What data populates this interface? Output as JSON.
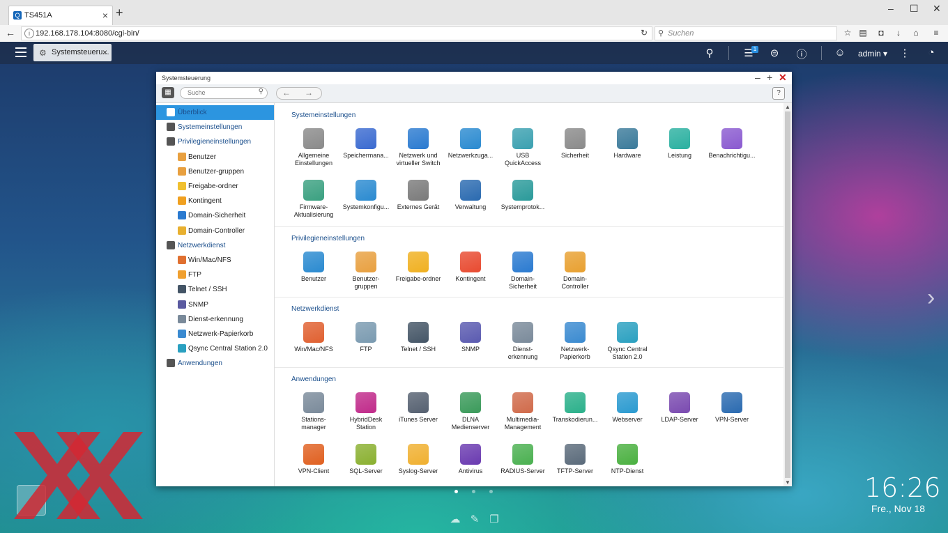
{
  "browser": {
    "tab_title": "TS451A",
    "address": "192.168.178.104:8080/cgi-bin/",
    "search_placeholder": "Suchen"
  },
  "qts": {
    "tab_label": "Systemsteueru...",
    "user": "admin",
    "notification_count": "1"
  },
  "window": {
    "title": "Systemsteuerung",
    "search_placeholder": "Suche",
    "help_label": "?"
  },
  "sidebar": [
    {
      "label": "Überblick",
      "level": "top",
      "selected": true,
      "icon": "overview-icon",
      "color": "#2c95e0"
    },
    {
      "label": "Systemeinstellungen",
      "level": "top",
      "icon": "gear-icon",
      "color": "#555555"
    },
    {
      "label": "Privilegieneinstellungen",
      "level": "top",
      "icon": "user-icon",
      "color": "#555555"
    },
    {
      "label": "Benutzer",
      "level": "sub",
      "icon": "user-icon",
      "color": "#e8a040"
    },
    {
      "label": "Benutzer-gruppen",
      "level": "sub",
      "icon": "users-icon",
      "color": "#e8a040"
    },
    {
      "label": "Freigabe-ordner",
      "level": "sub",
      "icon": "folder-icon",
      "color": "#f0c030"
    },
    {
      "label": "Kontingent",
      "level": "sub",
      "icon": "pie-icon",
      "color": "#f0a020"
    },
    {
      "label": "Domain-Sicherheit",
      "level": "sub",
      "icon": "domain-icon",
      "color": "#2a7ad0"
    },
    {
      "label": "Domain-Controller",
      "level": "sub",
      "icon": "controller-icon",
      "color": "#e8b030"
    },
    {
      "label": "Netzwerkdienst",
      "level": "top",
      "icon": "globe-icon",
      "color": "#555555"
    },
    {
      "label": "Win/Mac/NFS",
      "level": "sub",
      "icon": "triangle-icon",
      "color": "#e07030"
    },
    {
      "label": "FTP",
      "level": "sub",
      "icon": "ftp-icon",
      "color": "#f0a030"
    },
    {
      "label": "Telnet / SSH",
      "level": "sub",
      "icon": "terminal-icon",
      "color": "#445566"
    },
    {
      "label": "SNMP",
      "level": "sub",
      "icon": "chart-icon",
      "color": "#5a5aa0"
    },
    {
      "label": "Dienst-erkennung",
      "level": "sub",
      "icon": "satellite-icon",
      "color": "#7a8a9a"
    },
    {
      "label": "Netzwerk-Papierkorb",
      "level": "sub",
      "icon": "recycle-icon",
      "color": "#3a8ad0"
    },
    {
      "label": "Qsync Central Station 2.0",
      "level": "sub",
      "icon": "sync-icon",
      "color": "#2aa0c0"
    },
    {
      "label": "Anwendungen",
      "level": "top",
      "icon": "apps-icon",
      "color": "#555555"
    }
  ],
  "sections": [
    {
      "title": "Systemeinstellungen",
      "apps": [
        {
          "label": "Allgemeine\nEinstellungen",
          "icon": "settings-icon",
          "color": "#8a8a8a"
        },
        {
          "label": "Speichermana...",
          "icon": "storage-icon",
          "color": "#3a6ad0"
        },
        {
          "label": "Netzwerk und\nvirtueller Switch",
          "icon": "network-icon",
          "color": "#2a7ad0"
        },
        {
          "label": "Netzwerkzuga...",
          "icon": "network-access-icon",
          "color": "#2a8ad0"
        },
        {
          "label": "USB\nQuickAccess",
          "icon": "usb-icon",
          "color": "#3aa0b0"
        },
        {
          "label": "Sicherheit",
          "icon": "lock-icon",
          "color": "#8a8a8a"
        },
        {
          "label": "Hardware",
          "icon": "hardware-icon",
          "color": "#3a7a9a"
        },
        {
          "label": "Leistung",
          "icon": "bulb-icon",
          "color": "#2ab0a0"
        },
        {
          "label": "Benachrichtigu...",
          "icon": "notification-icon",
          "color": "#8a5ad0"
        },
        {
          "label": "Firmware-\nAktualisierung",
          "icon": "firmware-icon",
          "color": "#3aa080"
        },
        {
          "label": "Systemkonfigu...",
          "icon": "sysconfig-icon",
          "color": "#2a8ad0"
        },
        {
          "label": "Externes Gerät",
          "icon": "external-drive-icon",
          "color": "#7a7a7a"
        },
        {
          "label": "Verwaltung",
          "icon": "monitor-icon",
          "color": "#2a6ab0"
        },
        {
          "label": "Systemprotok...",
          "icon": "log-icon",
          "color": "#2a9a9a"
        }
      ]
    },
    {
      "title": "Privilegieneinstellungen",
      "apps": [
        {
          "label": "Benutzer",
          "icon": "user-icon",
          "color": "#2a8ad0"
        },
        {
          "label": "Benutzer-\ngruppen",
          "icon": "users-icon",
          "color": "#e8a040"
        },
        {
          "label": "Freigabe-ordner",
          "icon": "folder-icon",
          "color": "#f0b020"
        },
        {
          "label": "Kontingent",
          "icon": "pie-icon",
          "color": "#e84a30"
        },
        {
          "label": "Domain-\nSicherheit",
          "icon": "domain-icon",
          "color": "#2a7ad0"
        },
        {
          "label": "Domain-\nController",
          "icon": "controller-icon",
          "color": "#e8a030"
        }
      ]
    },
    {
      "title": "Netzwerkdienst",
      "apps": [
        {
          "label": "Win/Mac/NFS",
          "icon": "triangle-icon",
          "color": "#e06030"
        },
        {
          "label": "FTP",
          "icon": "ftp-icon",
          "color": "#7a9ab0"
        },
        {
          "label": "Telnet / SSH",
          "icon": "terminal-icon",
          "color": "#445566"
        },
        {
          "label": "SNMP",
          "icon": "chart-icon",
          "color": "#5a5ab0"
        },
        {
          "label": "Dienst-\nerkennung",
          "icon": "satellite-icon",
          "color": "#7a8a9a"
        },
        {
          "label": "Netzwerk-\nPapierkorb",
          "icon": "recycle-icon",
          "color": "#3a8ad0"
        },
        {
          "label": "Qsync Central\nStation 2.0",
          "icon": "sync-icon",
          "color": "#2aa0c0"
        }
      ]
    },
    {
      "title": "Anwendungen",
      "apps": [
        {
          "label": "Stations-\nmanager",
          "icon": "station-icon",
          "color": "#7a8a9a"
        },
        {
          "label": "HybridDesk\nStation",
          "icon": "hybriddesk-icon",
          "color": "#c02a8a"
        },
        {
          "label": "iTunes Server",
          "icon": "itunes-icon",
          "color": "#556070"
        },
        {
          "label": "DLNA\nMedienserver",
          "icon": "dlna-icon",
          "color": "#3a9a5a"
        },
        {
          "label": "Multimedia-\nManagement",
          "icon": "multimedia-icon",
          "color": "#d06a4a"
        },
        {
          "label": "Transkodierun...",
          "icon": "transcode-icon",
          "color": "#2ab08a"
        },
        {
          "label": "Webserver",
          "icon": "globe-icon",
          "color": "#2a9ad0"
        },
        {
          "label": "LDAP-Server",
          "icon": "ldap-icon",
          "color": "#7a4ab0"
        },
        {
          "label": "VPN-Server",
          "icon": "vpn-server-icon",
          "color": "#2a6ab0"
        },
        {
          "label": "VPN-Client",
          "icon": "vpn-client-icon",
          "color": "#e06020"
        },
        {
          "label": "SQL-Server",
          "icon": "database-icon",
          "color": "#8ab030"
        },
        {
          "label": "Syslog-Server",
          "icon": "syslog-icon",
          "color": "#f0b030"
        },
        {
          "label": "Antivirus",
          "icon": "antivirus-icon",
          "color": "#6a3ab0"
        },
        {
          "label": "RADIUS-Server",
          "icon": "radius-icon",
          "color": "#4ab050"
        },
        {
          "label": "TFTP-Server",
          "icon": "tftp-icon",
          "color": "#5a6a7a"
        },
        {
          "label": "NTP-Dienst",
          "icon": "ntp-icon",
          "color": "#4ab040"
        }
      ]
    }
  ],
  "desktop": {
    "time": "16:26",
    "date": "Fre., Nov 18"
  }
}
